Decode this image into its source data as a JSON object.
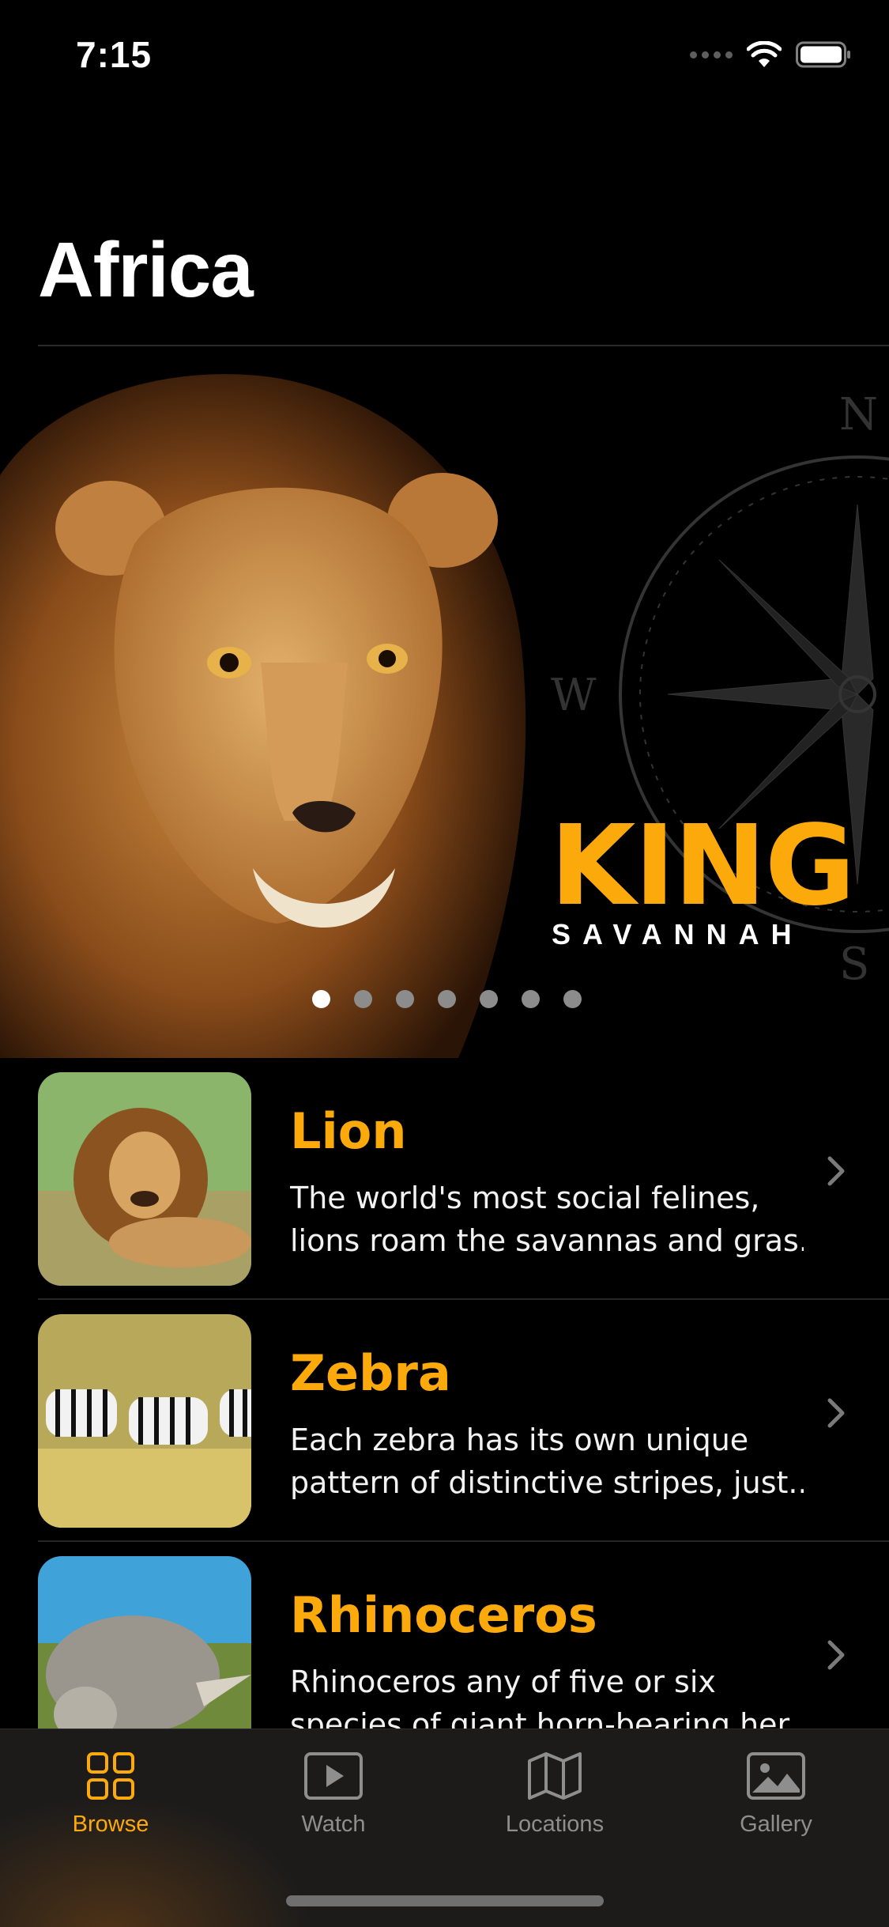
{
  "status_bar": {
    "time": "7:15"
  },
  "title": "Africa",
  "hero": {
    "title": "KING",
    "subtitle": "SAVANNAH",
    "compass": {
      "n": "N",
      "w": "W",
      "s": "S"
    },
    "page_count": 7,
    "active_page": 1
  },
  "animals": [
    {
      "name": "Lion",
      "desc_line1": "The world's most social felines,",
      "desc_line2": "lions roam the savannas and gras..."
    },
    {
      "name": "Zebra",
      "desc_line1": "Each zebra has its own unique",
      "desc_line2": "pattern of distinctive stripes, just..."
    },
    {
      "name": "Rhinoceros",
      "desc_line1": "Rhinoceros any of five or six",
      "desc_line2": "species of giant horn-bearing her..."
    }
  ],
  "tabs": [
    {
      "label": "Browse",
      "icon": "grid-icon",
      "active": true
    },
    {
      "label": "Watch",
      "icon": "play-icon",
      "active": false
    },
    {
      "label": "Locations",
      "icon": "map-icon",
      "active": false
    },
    {
      "label": "Gallery",
      "icon": "photo-icon",
      "active": false
    }
  ],
  "colors": {
    "accent": "#fcaa0b",
    "background": "#000000",
    "tab_bar": "#1c1b1a",
    "inactive": "#8e8e8e"
  }
}
